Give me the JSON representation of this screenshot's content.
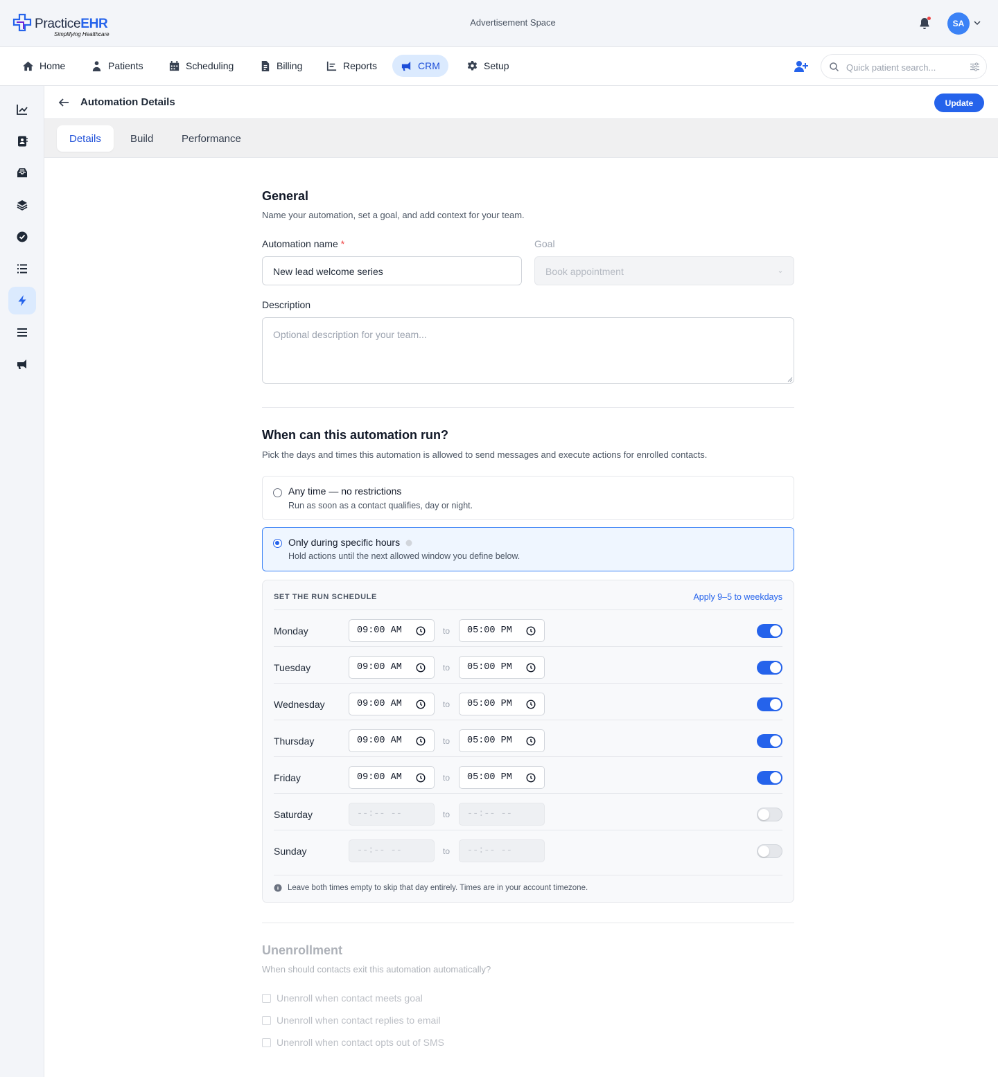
{
  "header": {
    "logo_main": "Practice",
    "logo_bold": "EHR",
    "logo_sub": "Simplifying Healthcare",
    "ad_space": "Advertisement Space",
    "avatar_initials": "SA"
  },
  "nav": {
    "items": [
      {
        "label": "Home",
        "icon": "home-icon"
      },
      {
        "label": "Patients",
        "icon": "patient-icon"
      },
      {
        "label": "Scheduling",
        "icon": "calendar-icon"
      },
      {
        "label": "Billing",
        "icon": "invoice-icon"
      },
      {
        "label": "Reports",
        "icon": "chart-icon"
      },
      {
        "label": "CRM",
        "icon": "megaphone-icon",
        "active": true
      },
      {
        "label": "Setup",
        "icon": "gear-icon"
      }
    ],
    "search_placeholder": "Quick patient search..."
  },
  "sidebar": {
    "items": [
      "trend-icon",
      "contact-book-icon",
      "inbox-icon",
      "layers-icon",
      "check-circle-icon",
      "list-icon",
      "bolt-icon",
      "menu-icon",
      "megaphone-icon"
    ],
    "active_index": 6
  },
  "page": {
    "title": "Automation Details",
    "update_label": "Update",
    "tabs": [
      {
        "label": "Details",
        "active": true
      },
      {
        "label": "Build"
      },
      {
        "label": "Performance"
      }
    ]
  },
  "general": {
    "heading": "General",
    "subtitle": "Name your automation, set a goal, and add context for your team.",
    "name_label": "Automation name",
    "required_mark": "*",
    "name_value": "New lead welcome series",
    "goal_label": "Goal",
    "goal_value": "Book appointment",
    "description_label": "Description",
    "description_placeholder": "Optional description for your team..."
  },
  "schedule": {
    "heading": "When can this automation run?",
    "subtitle": "Pick the days and times this automation is allowed to send messages and execute actions for enrolled contacts.",
    "options": [
      {
        "title": "Any time — no restrictions",
        "subtitle": "Run as soon as a contact qualifies, day or night.",
        "selected": false
      },
      {
        "title": "Only during specific hours",
        "subtitle": "Hold actions until the next allowed window you define below.",
        "selected": true
      }
    ],
    "panel_title": "SET THE RUN SCHEDULE",
    "apply_link": "Apply 9–5 to weekdays",
    "to_label": "to",
    "days": [
      {
        "day": "Monday",
        "start": "09:00 AM",
        "end": "05:00 PM",
        "enabled": true
      },
      {
        "day": "Tuesday",
        "start": "09:00 AM",
        "end": "05:00 PM",
        "enabled": true
      },
      {
        "day": "Wednesday",
        "start": "09:00 AM",
        "end": "05:00 PM",
        "enabled": true
      },
      {
        "day": "Thursday",
        "start": "09:00 AM",
        "end": "05:00 PM",
        "enabled": true
      },
      {
        "day": "Friday",
        "start": "09:00 AM",
        "end": "05:00 PM",
        "enabled": true
      },
      {
        "day": "Saturday",
        "start": "--:-- --",
        "end": "--:-- --",
        "enabled": false
      },
      {
        "day": "Sunday",
        "start": "--:-- --",
        "end": "--:-- --",
        "enabled": false
      }
    ],
    "note": "Leave both times empty to skip that day entirely. Times are in your account timezone."
  },
  "unenrollment": {
    "heading": "Unenrollment",
    "subtitle": "When should contacts exit this automation automatically?",
    "options": [
      "Unenroll when contact meets goal",
      "Unenroll when contact replies to email",
      "Unenroll when contact opts out of SMS"
    ]
  },
  "colors": {
    "accent": "#2563eb",
    "active_bg": "#dbeafe",
    "panel_bg": "#f8f9fb"
  }
}
